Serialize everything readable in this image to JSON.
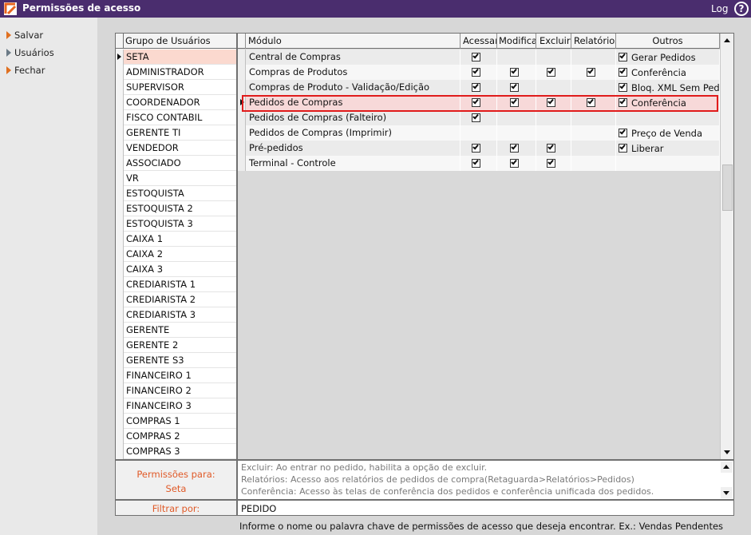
{
  "window": {
    "title": "Permissões de acesso",
    "log_label": "Log",
    "help_label": "?"
  },
  "menu": [
    {
      "label": "Salvar"
    },
    {
      "label": "Usuários"
    },
    {
      "label": "Fechar"
    }
  ],
  "groups": {
    "header": "Grupo de Usuários",
    "selected_index": 0,
    "items": [
      "SETA",
      "ADMINISTRADOR",
      "SUPERVISOR",
      "COORDENADOR",
      "FISCO CONTABIL",
      "GERENTE TI",
      "VENDEDOR",
      "ASSOCIADO",
      "VR",
      "ESTOQUISTA",
      "ESTOQUISTA 2",
      "ESTOQUISTA 3",
      "CAIXA 1",
      "CAIXA 2",
      "CAIXA 3",
      "CREDIARISTA 1",
      "CREDIARISTA 2",
      "CREDIARISTA 3",
      "GERENTE",
      "GERENTE 2",
      "GERENTE S3",
      "FINANCEIRO 1",
      "FINANCEIRO 2",
      "FINANCEIRO 3",
      "COMPRAS 1",
      "COMPRAS 2",
      "COMPRAS 3"
    ]
  },
  "modules": {
    "headers": {
      "modulo": "Módulo",
      "acessar": "Acessar",
      "modificar": "Modifica",
      "excluir": "Excluir",
      "relatorios": "Relatórios",
      "outros": "Outros"
    },
    "selected_index": 3,
    "rows": [
      {
        "name": "Central de Compras",
        "acessar": true,
        "modificar": false,
        "excluir": false,
        "relatorios": false,
        "outros": [
          {
            "label": "Gerar Pedidos",
            "checked": true
          }
        ]
      },
      {
        "name": "Compras de Produtos",
        "acessar": true,
        "modificar": true,
        "excluir": true,
        "relatorios": true,
        "outros": [
          {
            "label": "Conferência",
            "checked": true
          }
        ]
      },
      {
        "name": "Compras de Produto - Validação/Edição",
        "acessar": true,
        "modificar": true,
        "excluir": false,
        "relatorios": false,
        "outros": [
          {
            "label": "Bloq. XML Sem Pedid",
            "checked": true
          }
        ]
      },
      {
        "name": "Pedidos de Compras",
        "acessar": true,
        "modificar": true,
        "excluir": true,
        "relatorios": true,
        "outros": [
          {
            "label": "Conferência",
            "checked": true
          }
        ]
      },
      {
        "name": "Pedidos de Compras (Falteiro)",
        "acessar": true,
        "modificar": false,
        "excluir": false,
        "relatorios": false,
        "outros": []
      },
      {
        "name": "Pedidos de Compras (Imprimir)",
        "acessar": false,
        "modificar": false,
        "excluir": false,
        "relatorios": false,
        "outros": [
          {
            "label": "Preço de Venda",
            "checked": true
          }
        ]
      },
      {
        "name": "Pré-pedidos",
        "acessar": true,
        "modificar": true,
        "excluir": true,
        "relatorios": false,
        "outros": [
          {
            "label": "Liberar",
            "checked": true
          }
        ]
      },
      {
        "name": "Terminal - Controle",
        "acessar": true,
        "modificar": true,
        "excluir": true,
        "relatorios": false,
        "outros": []
      }
    ]
  },
  "permissions": {
    "label": "Permissões para:",
    "group": "Seta",
    "description_lines": [
      "Excluir: Ao entrar no pedido, habilita a opção de excluir.",
      "Relatórios: Acesso aos relatórios de pedidos de compra(Retaguarda>Relatórios>Pedidos)",
      "Conferência: Acesso às telas de conferência dos pedidos e conferência unificada dos pedidos."
    ]
  },
  "filter": {
    "label": "Filtrar por:",
    "value": "PEDIDO",
    "hint": "Informe o nome ou palavra chave de permissões de acesso que deseja encontrar. Ex.: Vendas Pendentes"
  },
  "colors": {
    "titlebar": "#4a2d6e",
    "accent": "#e05a28",
    "selection": "#fbd9cf",
    "highlight_border": "#e01b1b"
  }
}
